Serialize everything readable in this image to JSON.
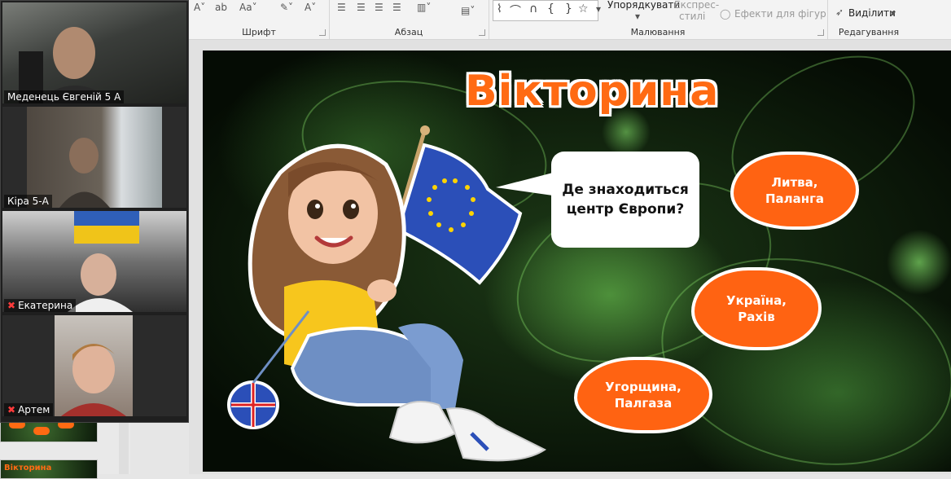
{
  "ribbon": {
    "groups": {
      "font": "Шрифт",
      "paragraph": "Абзац",
      "drawing": "Малювання",
      "editing": "Редагування"
    },
    "arrange_label": "Упорядкувати",
    "quick_styles_label": "Експрес-стилі",
    "quick_styles_line1": "Експрес-",
    "quick_styles_line2": "стилі",
    "shape_effects_label": "Ефекти для фігур",
    "select_label": "Виділити"
  },
  "slide": {
    "title": "Вікторина",
    "question_line1": "Де знаходиться",
    "question_line2": "центр Європи?",
    "answers": [
      {
        "line1": "Литва,",
        "line2": "Паланга"
      },
      {
        "line1": "Україна,",
        "line2": "Рахів"
      },
      {
        "line1": "Угорщина,",
        "line2": "Палгаза"
      }
    ]
  },
  "thumbnails": {
    "next_title": "Вікторина"
  },
  "participants": [
    {
      "name": "Меденець Євгеній 5 А",
      "muted": false
    },
    {
      "name": "Кіра 5-А",
      "muted": false
    },
    {
      "name": "Екатерина",
      "muted": true
    },
    {
      "name": "Артем",
      "muted": true
    }
  ],
  "colors": {
    "accent_orange": "#ff6312",
    "slide_bg": "#0f200c",
    "muted_icon": "#ff3b3b"
  }
}
